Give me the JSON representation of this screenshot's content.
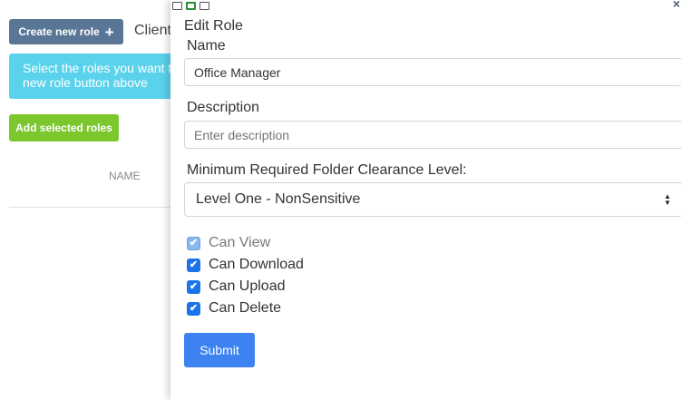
{
  "background": {
    "create_button_label": "Create new role",
    "client_label": "Client",
    "info_line1": "Select the roles you want t",
    "info_line2": "new role button above",
    "add_selected_label": "Add selected roles",
    "column_header": "NAME"
  },
  "modal": {
    "title": "Edit Role",
    "name_label": "Name",
    "name_value": "Office Manager",
    "description_label": "Description",
    "description_placeholder": "Enter description",
    "clearance_label": "Minimum Required Folder Clearance Level:",
    "clearance_selected": "Level One - NonSensitive",
    "permissions": [
      {
        "label": "Can View",
        "checked": true,
        "disabled": true
      },
      {
        "label": "Can Download",
        "checked": true,
        "disabled": false
      },
      {
        "label": "Can Upload",
        "checked": true,
        "disabled": false
      },
      {
        "label": "Can Delete",
        "checked": true,
        "disabled": false
      }
    ],
    "submit_label": "Submit",
    "check_glyph": "✔",
    "close_glyph": "×"
  },
  "colors": {
    "create_button": "#5a7696",
    "info_box": "#5ad2ec",
    "add_button": "#7cc62e",
    "submit_button": "#3d82f0",
    "checkbox": "#1a73e8"
  }
}
